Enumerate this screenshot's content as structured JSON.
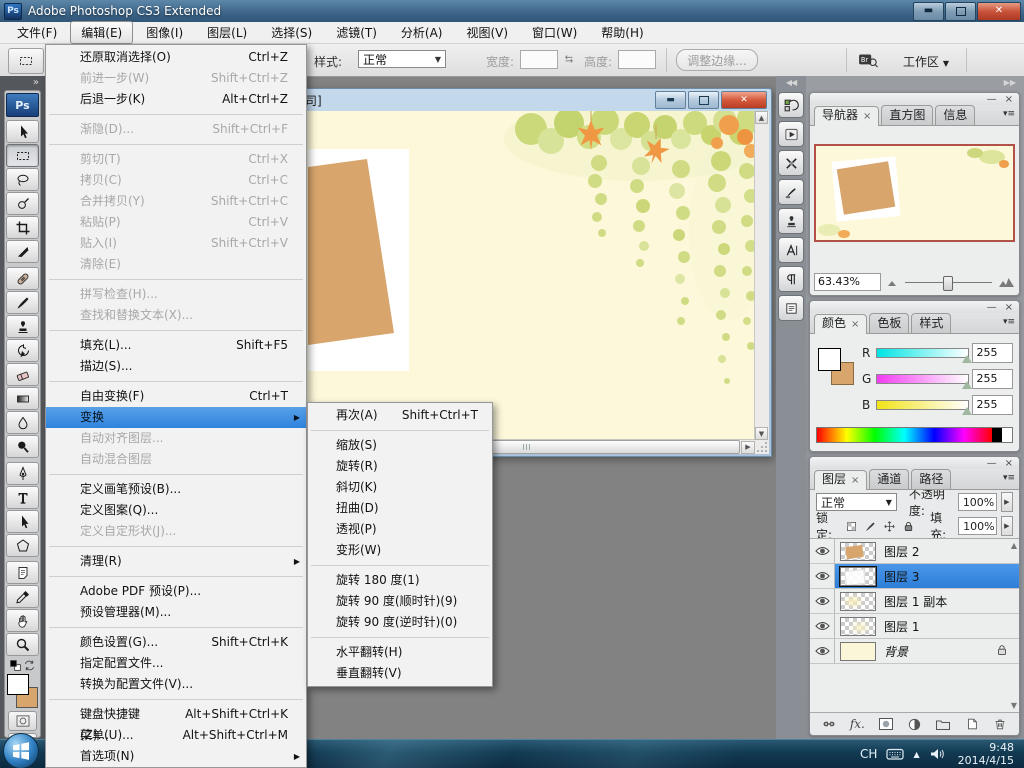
{
  "titlebar": {
    "app_name": "Adobe Photoshop CS3 Extended",
    "logo_text": "Ps"
  },
  "menubar": {
    "items": [
      {
        "label": "文件(F)"
      },
      {
        "label": "编辑(E)",
        "active": true
      },
      {
        "label": "图像(I)"
      },
      {
        "label": "图层(L)"
      },
      {
        "label": "选择(S)"
      },
      {
        "label": "滤镜(T)"
      },
      {
        "label": "分析(A)"
      },
      {
        "label": "视图(V)"
      },
      {
        "label": "窗口(W)"
      },
      {
        "label": "帮助(H)"
      }
    ]
  },
  "options_bar": {
    "style_label": "样式:",
    "style_value": "正常",
    "width_label": "宽度:",
    "width_value": "",
    "height_label": "高度:",
    "height_value": "",
    "refine_edge_label": "调整边缘...",
    "workspace_label": "工作区"
  },
  "edit_menu": {
    "items": [
      {
        "label": "还原取消选择(O)",
        "shortcut": "Ctrl+Z"
      },
      {
        "label": "前进一步(W)",
        "shortcut": "Shift+Ctrl+Z",
        "disabled": true
      },
      {
        "label": "后退一步(K)",
        "shortcut": "Alt+Ctrl+Z"
      },
      {
        "type": "sep"
      },
      {
        "label": "渐隐(D)...",
        "shortcut": "Shift+Ctrl+F",
        "disabled": true
      },
      {
        "type": "sep"
      },
      {
        "label": "剪切(T)",
        "shortcut": "Ctrl+X",
        "disabled": true
      },
      {
        "label": "拷贝(C)",
        "shortcut": "Ctrl+C",
        "disabled": true
      },
      {
        "label": "合并拷贝(Y)",
        "shortcut": "Shift+Ctrl+C",
        "disabled": true
      },
      {
        "label": "粘贴(P)",
        "shortcut": "Ctrl+V",
        "disabled": true
      },
      {
        "label": "贴入(I)",
        "shortcut": "Shift+Ctrl+V",
        "disabled": true
      },
      {
        "label": "清除(E)",
        "disabled": true
      },
      {
        "type": "sep"
      },
      {
        "label": "拼写检查(H)...",
        "disabled": true
      },
      {
        "label": "查找和替换文本(X)...",
        "disabled": true
      },
      {
        "type": "sep"
      },
      {
        "label": "填充(L)...",
        "shortcut": "Shift+F5"
      },
      {
        "label": "描边(S)..."
      },
      {
        "type": "sep"
      },
      {
        "label": "自由变换(F)",
        "shortcut": "Ctrl+T"
      },
      {
        "label": "变换",
        "selected": true,
        "submenu": true
      },
      {
        "label": "自动对齐图层...",
        "disabled": true
      },
      {
        "label": "自动混合图层",
        "disabled": true
      },
      {
        "type": "sep"
      },
      {
        "label": "定义画笔预设(B)..."
      },
      {
        "label": "定义图案(Q)..."
      },
      {
        "label": "定义自定形状(J)...",
        "disabled": true
      },
      {
        "type": "sep"
      },
      {
        "label": "清理(R)",
        "submenu": true
      },
      {
        "type": "sep"
      },
      {
        "label": "Adobe PDF 预设(P)..."
      },
      {
        "label": "预设管理器(M)..."
      },
      {
        "type": "sep"
      },
      {
        "label": "颜色设置(G)...",
        "shortcut": "Shift+Ctrl+K"
      },
      {
        "label": "指定配置文件..."
      },
      {
        "label": "转换为配置文件(V)..."
      },
      {
        "type": "sep"
      },
      {
        "label": "键盘快捷键(Z)...",
        "shortcut": "Alt+Shift+Ctrl+K"
      },
      {
        "label": "菜单(U)...",
        "shortcut": "Alt+Shift+Ctrl+M"
      },
      {
        "label": "首选项(N)",
        "submenu": true
      }
    ]
  },
  "transform_submenu": {
    "items": [
      {
        "label": "再次(A)",
        "shortcut": "Shift+Ctrl+T"
      },
      {
        "type": "sep"
      },
      {
        "label": "缩放(S)"
      },
      {
        "label": "旋转(R)"
      },
      {
        "label": "斜切(K)"
      },
      {
        "label": "扭曲(D)"
      },
      {
        "label": "透视(P)"
      },
      {
        "label": "变形(W)"
      },
      {
        "type": "sep"
      },
      {
        "label": "旋转 180 度(1)"
      },
      {
        "label": "旋转 90 度(顺时针)(9)"
      },
      {
        "label": "旋转 90 度(逆时针)(0)"
      },
      {
        "type": "sep"
      },
      {
        "label": "水平翻转(H)"
      },
      {
        "label": "垂直翻转(V)"
      }
    ]
  },
  "toolbox": {
    "logo_text": "Ps",
    "tools": [
      {
        "icon": "move-tool"
      },
      {
        "icon": "rectangular-marquee-tool",
        "selected": true
      },
      {
        "icon": "lasso-tool"
      },
      {
        "icon": "quick-selection-tool"
      },
      {
        "icon": "crop-tool"
      },
      {
        "icon": "slice-tool"
      },
      {
        "icon": "healing-brush-tool",
        "group": true
      },
      {
        "icon": "brush-tool"
      },
      {
        "icon": "clone-stamp-tool"
      },
      {
        "icon": "history-brush-tool"
      },
      {
        "icon": "eraser-tool"
      },
      {
        "icon": "gradient-tool"
      },
      {
        "icon": "blur-tool"
      },
      {
        "icon": "dodge-tool"
      },
      {
        "icon": "pen-tool",
        "group": true
      },
      {
        "icon": "type-tool"
      },
      {
        "icon": "path-selection-tool"
      },
      {
        "icon": "shape-tool"
      },
      {
        "icon": "notes-tool",
        "group": true
      },
      {
        "icon": "eyedropper-tool"
      },
      {
        "icon": "hand-tool"
      },
      {
        "icon": "zoom-tool"
      }
    ],
    "foreground_color": "#ffffff",
    "background_color": "#d8a56c"
  },
  "document_window": {
    "title_fragment": "司]"
  },
  "panel_strip": {
    "icons": [
      "history",
      "actions",
      "tool-presets",
      "brushes",
      "clone-source",
      "character",
      "paragraph",
      "layer-comps"
    ]
  },
  "navigator_panel": {
    "tabs": [
      {
        "label": "导航器",
        "active": true
      },
      {
        "label": "直方图"
      },
      {
        "label": "信息"
      }
    ],
    "zoom_value": "63.43%"
  },
  "color_panel": {
    "tabs": [
      {
        "label": "颜色",
        "active": true
      },
      {
        "label": "色板"
      },
      {
        "label": "样式"
      }
    ],
    "channels": [
      {
        "label": "R",
        "value": "255",
        "track": "cyan"
      },
      {
        "label": "G",
        "value": "255",
        "track": "magenta"
      },
      {
        "label": "B",
        "value": "255",
        "track": "yellow"
      }
    ]
  },
  "layers_panel": {
    "tabs": [
      {
        "label": "图层",
        "active": true
      },
      {
        "label": "通道"
      },
      {
        "label": "路径"
      }
    ],
    "blend_mode": "正常",
    "opacity_label": "不透明度:",
    "opacity_value": "100%",
    "lock_label": "锁定:",
    "fill_label": "填充:",
    "fill_value": "100%",
    "rows": [
      {
        "name": "图层 2",
        "thumb": "tan-shape"
      },
      {
        "name": "图层 3",
        "thumb": "white-shape",
        "selected": true
      },
      {
        "name": "图层 1 副本",
        "thumb": "pale-wisp"
      },
      {
        "name": "图层 1",
        "thumb": "pale-wisp2"
      },
      {
        "name": "背景",
        "thumb": "background",
        "locked": true,
        "italic": true
      }
    ]
  },
  "taskbar": {
    "lang_indicator": "CH",
    "time": "9:48",
    "date": "2014/4/15"
  },
  "colors": {
    "selection_blue": "#3a8ae4",
    "canvas_cream": "#fdf8da",
    "photo_tan": "#d8a56c",
    "navigator_border": "#b25148",
    "taskbar_navy": "#123a52"
  }
}
